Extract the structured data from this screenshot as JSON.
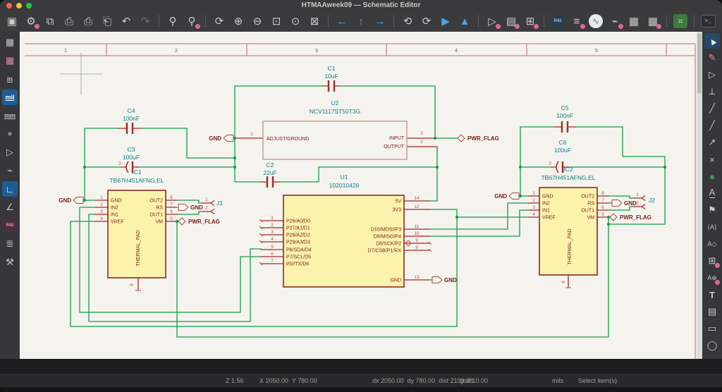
{
  "window": {
    "title": "HTMAAweek09 — Schematic Editor"
  },
  "toolbar_top": {
    "items": [
      {
        "id": "save",
        "glyph": "▣"
      },
      {
        "id": "schematic-setup",
        "glyph": "⚙"
      },
      {
        "id": "page-settings",
        "glyph": "⧉"
      },
      {
        "id": "print",
        "glyph": "⎙"
      },
      {
        "id": "plot",
        "glyph": "⎙"
      },
      {
        "id": "paste",
        "glyph": "⎗"
      },
      {
        "id": "undo",
        "glyph": "↶"
      },
      {
        "id": "redo",
        "glyph": "↷"
      },
      {
        "id": "find",
        "glyph": "⚲"
      },
      {
        "id": "find-replace",
        "glyph": "⚲"
      },
      {
        "id": "refresh",
        "glyph": "⟳"
      },
      {
        "id": "zoom-in",
        "glyph": "⊕"
      },
      {
        "id": "zoom-out",
        "glyph": "⊖"
      },
      {
        "id": "zoom-page",
        "glyph": "⊡"
      },
      {
        "id": "zoom-objects",
        "glyph": "⊙"
      },
      {
        "id": "zoom-selection",
        "glyph": "⊠"
      },
      {
        "id": "nav-back",
        "glyph": "←"
      },
      {
        "id": "nav-up",
        "glyph": "↑"
      },
      {
        "id": "nav-forward",
        "glyph": "→"
      },
      {
        "id": "rotate-ccw",
        "glyph": "⟲"
      },
      {
        "id": "rotate-cw",
        "glyph": "⟳"
      },
      {
        "id": "mirror-h",
        "glyph": "▶"
      },
      {
        "id": "mirror-v",
        "glyph": "▲"
      },
      {
        "id": "edit-symbol",
        "glyph": "▷"
      },
      {
        "id": "library-browser",
        "glyph": "▤"
      },
      {
        "id": "footprint-assign",
        "glyph": "⊞"
      },
      {
        "id": "symbol-fields-table",
        "glyph": "R42"
      },
      {
        "id": "annotate",
        "glyph": "≡"
      },
      {
        "id": "simulator",
        "glyph": "∿"
      },
      {
        "id": "erc",
        "glyph": "⌁"
      },
      {
        "id": "net-table",
        "glyph": "▦"
      },
      {
        "id": "bom",
        "glyph": "▦"
      },
      {
        "id": "open-pcb-editor",
        "glyph": "⌗"
      },
      {
        "id": "scripting-console",
        "glyph": ">_"
      }
    ]
  },
  "toolbar_left": {
    "items": [
      {
        "id": "grid-toggle",
        "glyph": "▦"
      },
      {
        "id": "grid-settings",
        "glyph": "▦"
      },
      {
        "id": "units-inches",
        "glyph": "in"
      },
      {
        "id": "units-mils",
        "glyph": "mil"
      },
      {
        "id": "units-mm",
        "glyph": "mm"
      },
      {
        "id": "cursor-shape",
        "glyph": "⌖"
      },
      {
        "id": "selection-filter",
        "glyph": "▷"
      },
      {
        "id": "wire-mode-free",
        "glyph": "⌁"
      },
      {
        "id": "wire-mode-orthogonal",
        "glyph": "∟"
      },
      {
        "id": "wire-mode-45",
        "glyph": "∠"
      },
      {
        "id": "symbol-fields",
        "glyph": "R42"
      },
      {
        "id": "hierarchy-navigator",
        "glyph": "≣"
      },
      {
        "id": "tools",
        "glyph": "⚒"
      }
    ]
  },
  "toolbar_right": {
    "items": [
      {
        "id": "select-tool",
        "glyph": "▲"
      },
      {
        "id": "highlight-net",
        "glyph": "✎"
      },
      {
        "id": "place-symbol",
        "glyph": "▷"
      },
      {
        "id": "place-power",
        "glyph": "⟂"
      },
      {
        "id": "draw-wire",
        "glyph": "╱"
      },
      {
        "id": "draw-bus",
        "glyph": "╱"
      },
      {
        "id": "bus-entry",
        "glyph": "↗"
      },
      {
        "id": "no-connect",
        "glyph": "×"
      },
      {
        "id": "junction",
        "glyph": "●"
      },
      {
        "id": "net-label",
        "glyph": "A"
      },
      {
        "id": "directive-label",
        "glyph": "⚑"
      },
      {
        "id": "global-label",
        "glyph": "⟨A⟩"
      },
      {
        "id": "hierarchical-label",
        "glyph": "A◇"
      },
      {
        "id": "hierarchical-sheet",
        "glyph": "⊞"
      },
      {
        "id": "sheet-pin",
        "glyph": "A⊕"
      },
      {
        "id": "text",
        "glyph": "T"
      },
      {
        "id": "textbox",
        "glyph": "▤"
      },
      {
        "id": "rectangle",
        "glyph": "▭"
      },
      {
        "id": "circle",
        "glyph": "◯"
      }
    ]
  },
  "statusbar": {
    "zoom_level": "Z 1.56",
    "cursor_pos": "X 2050.00  Y 780.00",
    "delta": "dx 2050.00  dy 780.00  dist 2193.38",
    "grid": "grid 10.00",
    "units": "mils",
    "hint": "Select item(s)"
  },
  "sheet": {
    "ruler_numbers": [
      "1",
      "2",
      "3",
      "4",
      "5"
    ]
  },
  "schematic": {
    "nets": {
      "gnd": "GND",
      "pwr_flag": "PWR_FLAG"
    },
    "components": {
      "c1": {
        "ref": "C1",
        "value": "10uF"
      },
      "c2": {
        "ref": "C2",
        "value": "22uF"
      },
      "c3": {
        "ref": "C3",
        "value": "100uF",
        "pol": "2"
      },
      "c4": {
        "ref": "C4",
        "value": "100nF"
      },
      "c5": {
        "ref": "C5",
        "value": "100nF"
      },
      "c6": {
        "ref": "C6",
        "value": "100uF",
        "pol": "2"
      },
      "u2": {
        "ref": "U2",
        "value": "NCV1117ST50T3G",
        "pin1_num": "1",
        "pin1_name": "ADJUST/GROUND",
        "pin3_num": "3",
        "pin3_name": "INPUT",
        "pin2_num": "2",
        "pin2_name": "OUTPUT"
      },
      "u1": {
        "ref": "U1",
        "value": "102010428",
        "left": [
          {
            "n": "1",
            "name": "P26/A0/D0"
          },
          {
            "n": "2",
            "name": "P27/A1/D1"
          },
          {
            "n": "3",
            "name": "P28/A2/D2"
          },
          {
            "n": "4",
            "name": "P29/A3/D3"
          },
          {
            "n": "5",
            "name": "P6/SDA/D4"
          },
          {
            "n": "6",
            "name": "P7/SCL/D5"
          },
          {
            "n": "7",
            "name": "P0//TX/D6"
          }
        ],
        "right": [
          {
            "n": "14",
            "name": "5V"
          },
          {
            "n": "12",
            "name": "3V3"
          },
          {
            "n": "11",
            "name": "D10/MOSI/P3"
          },
          {
            "n": "10",
            "name": "D9/MISO/P4"
          },
          {
            "n": "9",
            "name": "D8/SCK/P2"
          },
          {
            "n": "8",
            "name": "D7/CSB/P1/RX"
          },
          {
            "n": "13",
            "name": "GND"
          }
        ]
      },
      "ic1": {
        "ref": "IC1",
        "value": "TB67H451AFNG,EL",
        "left": [
          {
            "n": "1",
            "name": "GND"
          },
          {
            "n": "2",
            "name": "IN2"
          },
          {
            "n": "3",
            "name": "IN1"
          },
          {
            "n": "4",
            "name": "VREF"
          }
        ],
        "right": [
          {
            "n": "8",
            "name": "OUT2"
          },
          {
            "n": "7",
            "name": "RS"
          },
          {
            "n": "6",
            "name": "OUT1"
          },
          {
            "n": "5",
            "name": "VM"
          }
        ],
        "pad": "THERMAL_PAD",
        "pad_pin": "9"
      },
      "ic2": {
        "ref": "IC2",
        "value": "TB67H451AFNG,EL",
        "left": [
          {
            "n": "1",
            "name": "GND"
          },
          {
            "n": "2",
            "name": "IN2"
          },
          {
            "n": "3",
            "name": "IN1"
          },
          {
            "n": "4",
            "name": "VREF"
          }
        ],
        "right": [
          {
            "n": "8",
            "name": "OUT2"
          },
          {
            "n": "7",
            "name": "RS"
          },
          {
            "n": "6",
            "name": "OUT1"
          },
          {
            "n": "5",
            "name": "VM"
          }
        ],
        "pad": "THERMAL_PAD",
        "pad_pin": "9"
      },
      "j1": {
        "ref": "J1",
        "pins": [
          "1",
          "2"
        ]
      },
      "j2": {
        "ref": "J2",
        "pins": [
          "1",
          "2"
        ]
      }
    },
    "colors": {
      "wire": "#139c4d",
      "pin": "#a52828",
      "outline": "#8a1a1a",
      "fill": "#fbf3ac",
      "reference": "#0e7c8a",
      "label": "#7a1c1c",
      "background": "#f4f3ed"
    }
  }
}
